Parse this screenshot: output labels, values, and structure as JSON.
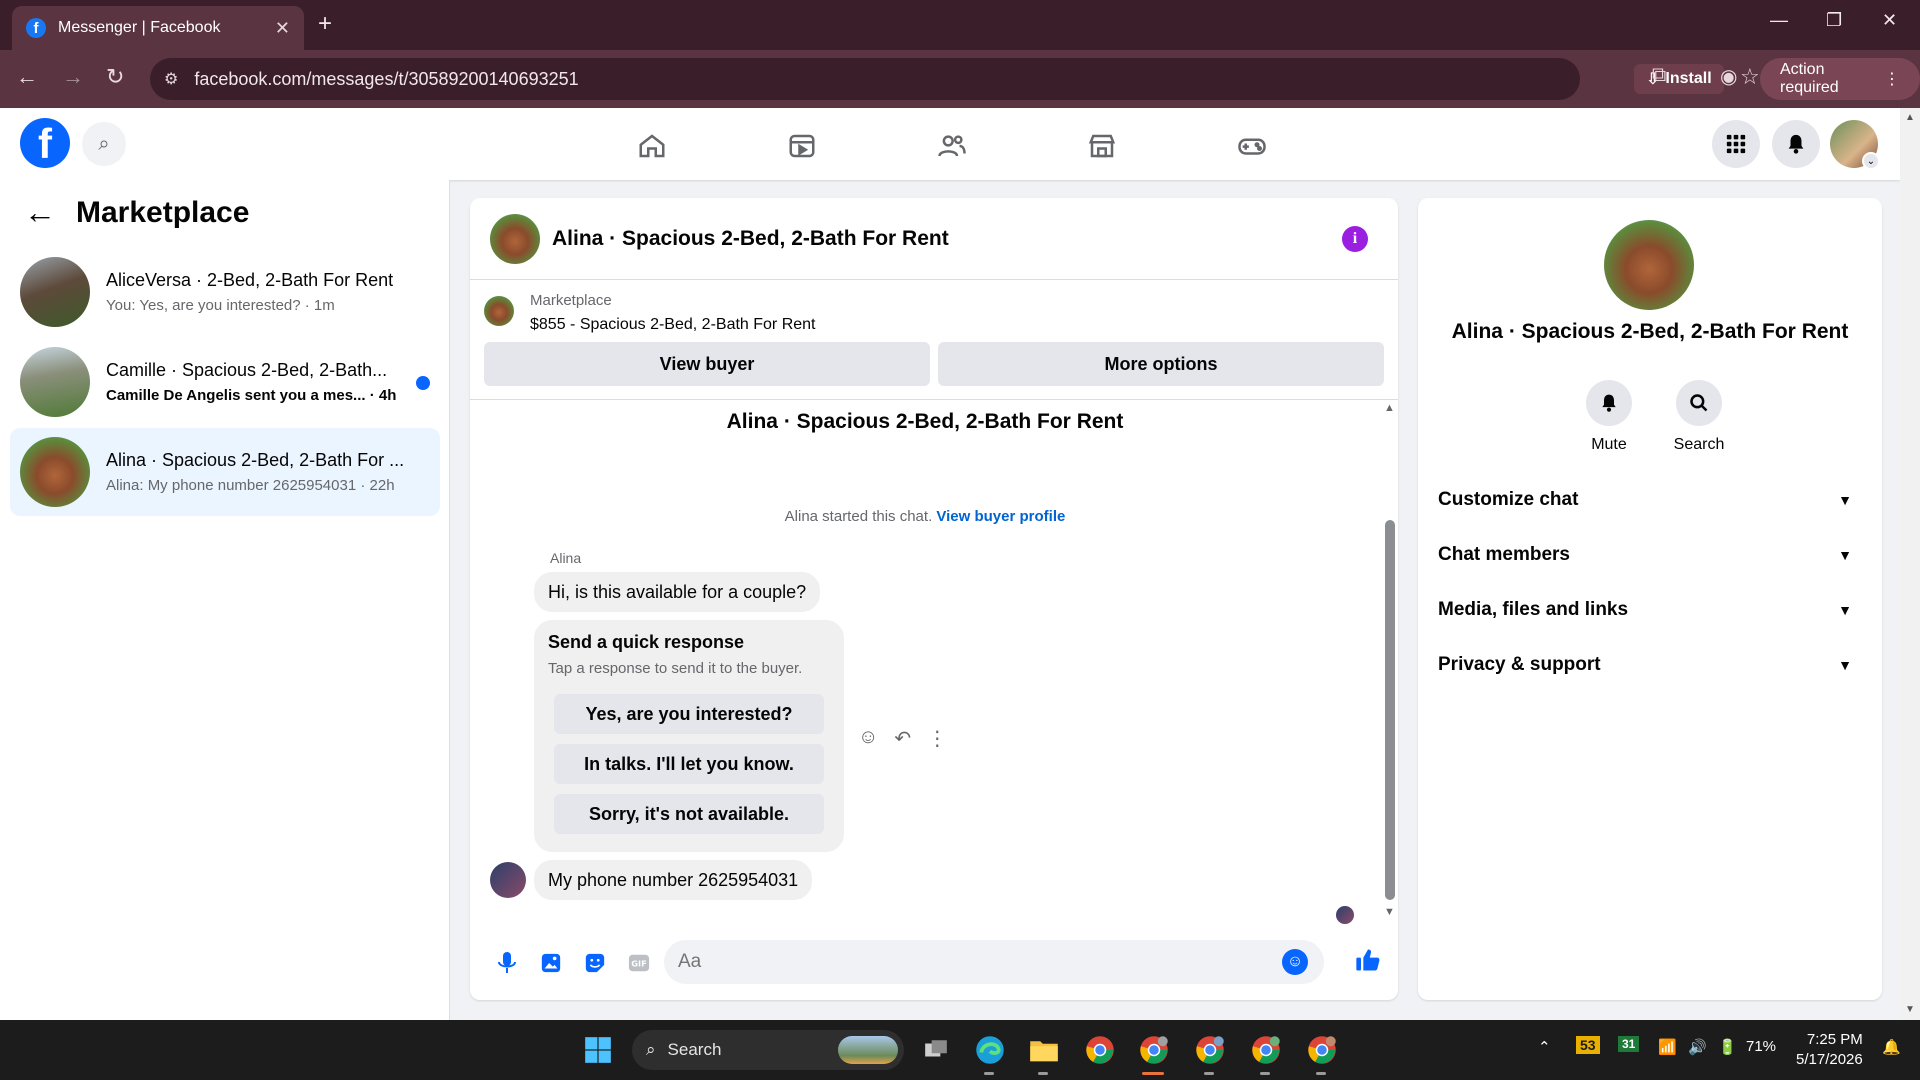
{
  "browser": {
    "tab_title": "Messenger | Facebook",
    "url": "facebook.com/messages/t/30589200140693251",
    "install_label": "Install",
    "action_required_label": "Action required"
  },
  "sidebar": {
    "title": "Marketplace",
    "conversations": [
      {
        "name": "AliceVersa · 2-Bed, 2-Bath For Rent",
        "snippet": "You: Yes, are you interested? · 1m",
        "unread": false,
        "active": false
      },
      {
        "name": "Camille · Spacious 2-Bed, 2-Bath...",
        "snippet": "Camille De Angelis sent you a mes... · 4h",
        "unread": true,
        "active": false
      },
      {
        "name": "Alina · Spacious 2-Bed, 2-Bath For ...",
        "snippet": "Alina: My phone number 2625954031 · 22h",
        "unread": false,
        "active": true
      }
    ]
  },
  "chat": {
    "header_name": "Alina · Spacious 2-Bed, 2-Bath For Rent",
    "marketplace_label": "Marketplace",
    "listing_price": "$855 - Spacious 2-Bed, 2-Bath For Rent",
    "view_buyer_label": "View buyer",
    "more_options_label": "More options",
    "thread_title": "Alina · Spacious 2-Bed, 2-Bath For Rent",
    "started_text": "Alina started this chat.",
    "view_buyer_profile_label": "View buyer profile",
    "sender_name": "Alina",
    "first_message": "Hi, is this available for a couple?",
    "quick_response_title": "Send a quick response",
    "quick_response_subtitle": "Tap a response to send it to the buyer.",
    "quick_responses": [
      "Yes, are you interested?",
      "In talks. I'll let you know.",
      "Sorry, it's not available."
    ],
    "last_message": "My phone number 2625954031",
    "composer_placeholder": "Aa",
    "composer_value": ""
  },
  "right_panel": {
    "name": "Alina · Spacious 2-Bed, 2-Bath For Rent",
    "mute_label": "Mute",
    "search_label": "Search",
    "sections": [
      "Customize chat",
      "Chat members",
      "Media, files and links",
      "Privacy & support"
    ]
  },
  "taskbar": {
    "search_label": "Search",
    "weather_badge": "53",
    "calendar_badge": "31",
    "battery": "71%",
    "time": "7:25 PM",
    "date": "5/17/2026"
  },
  "colors": {
    "fb_blue": "#0866ff",
    "chrome_dark": "#3a1f2a",
    "chrome_mid": "#5a3440",
    "info_purple": "#9b1fe0"
  }
}
